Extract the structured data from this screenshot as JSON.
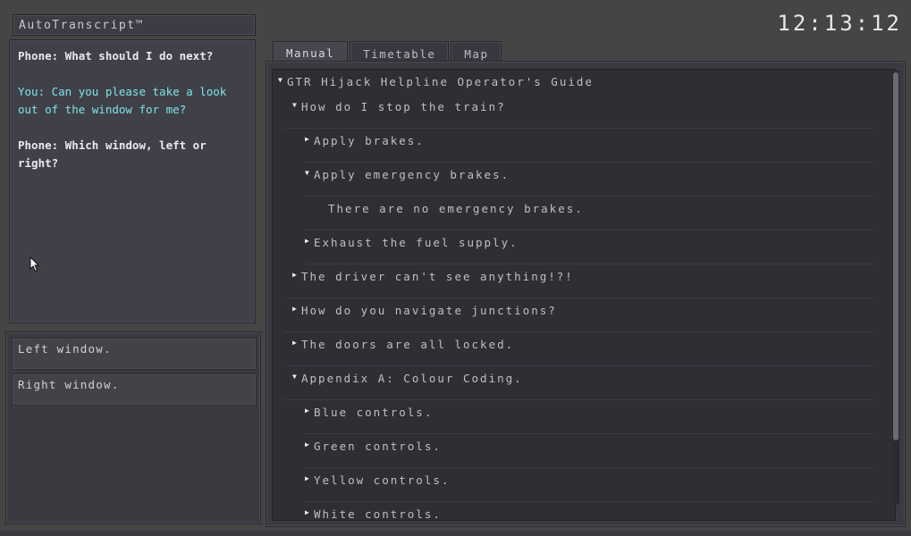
{
  "transcript": {
    "title": "AutoTranscript™",
    "messages": [
      {
        "speaker": "phone",
        "text": "Phone: What should I do next?"
      },
      {
        "speaker": "you",
        "text": "You: Can you please take a look out of the window for me?"
      },
      {
        "speaker": "phone",
        "text": "Phone: Which window, left or right?"
      }
    ]
  },
  "options": [
    "Left window.",
    "Right window."
  ],
  "clock": "12:13:12",
  "tabs": [
    {
      "label": "Manual",
      "active": true
    },
    {
      "label": "Timetable",
      "active": false
    },
    {
      "label": "Map",
      "active": false
    }
  ],
  "manual": {
    "rows": [
      {
        "level": 0,
        "expanded": true,
        "text": "GTR Hijack Helpline Operator's Guide"
      },
      {
        "level": 1,
        "expanded": true,
        "text": "How do I stop the train?"
      },
      {
        "level": 2,
        "expanded": false,
        "text": "Apply brakes."
      },
      {
        "level": 2,
        "expanded": true,
        "text": "Apply emergency brakes."
      },
      {
        "level": 3,
        "expanded": null,
        "text": "There are no emergency brakes."
      },
      {
        "level": 2,
        "expanded": false,
        "text": "Exhaust the fuel supply."
      },
      {
        "level": 1,
        "expanded": false,
        "text": "The driver can't see anything!?!"
      },
      {
        "level": 1,
        "expanded": false,
        "text": "How do you navigate junctions?"
      },
      {
        "level": 1,
        "expanded": false,
        "text": "The doors are all locked."
      },
      {
        "level": 1,
        "expanded": true,
        "text": "Appendix A: Colour Coding."
      },
      {
        "level": 2,
        "expanded": false,
        "text": "Blue controls."
      },
      {
        "level": 2,
        "expanded": false,
        "text": "Green controls."
      },
      {
        "level": 2,
        "expanded": false,
        "text": "Yellow controls."
      },
      {
        "level": 2,
        "expanded": false,
        "text": "White controls."
      }
    ]
  },
  "colors": {
    "you_text": "#7ee3e6",
    "phone_text": "#e9e9ee"
  }
}
